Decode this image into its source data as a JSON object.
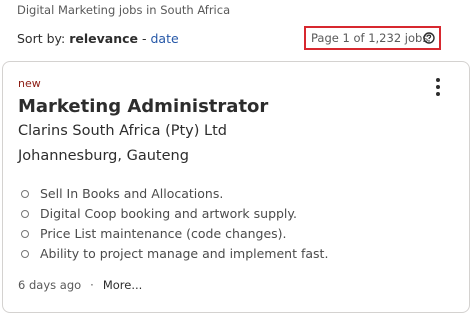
{
  "header": {
    "subtitle": "Digital Marketing jobs in South Africa",
    "sort_prefix": "Sort by:",
    "sort_active": "relevance",
    "sort_separator": " - ",
    "sort_alt": "date",
    "page_count": "Page 1 of 1,232 jobs"
  },
  "job": {
    "badge": "new",
    "title": "Marketing Administrator",
    "company": "Clarins South Africa (Pty) Ltd",
    "location": "Johannesburg, Gauteng",
    "snippet": [
      "Sell In Books and Allocations.",
      "Digital Coop booking and artwork supply.",
      "Price List maintenance (code changes).",
      "Ability to project manage and implement fast."
    ],
    "posted": "6 days ago",
    "dot": "·",
    "more": "More..."
  },
  "icons": {
    "help": "question-circle-icon",
    "menu": "more-vertical-icon"
  },
  "colors": {
    "highlight_border": "#d7282f",
    "link": "#2557a7",
    "new_badge": "#8c1c13"
  }
}
